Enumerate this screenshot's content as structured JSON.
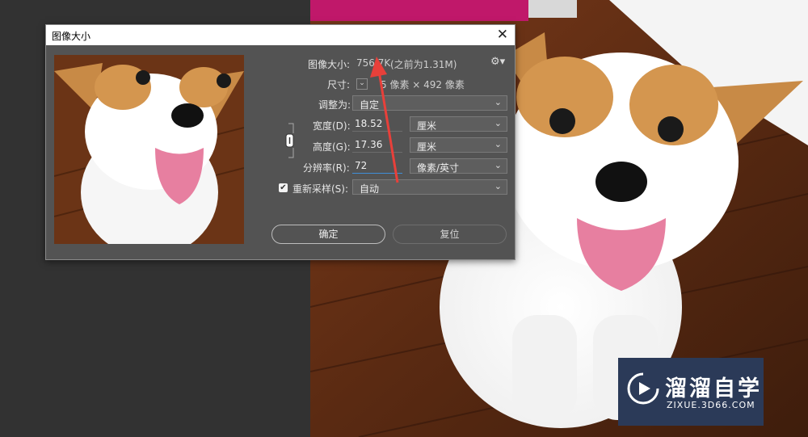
{
  "dialog": {
    "title": "图像大小",
    "close_glyph": "✕",
    "image_size_label": "图像大小:",
    "image_size_value": "756.7K",
    "image_size_prev": "(之前为1.31M)",
    "dimensions_label": "尺寸:",
    "dimensions_value": "5 像素 × 492 像素",
    "fit_label": "调整为:",
    "fit_value": "自定",
    "width_label": "宽度(D):",
    "width_value": "18.52",
    "width_unit": "厘米",
    "height_label": "高度(G):",
    "height_value": "17.36",
    "height_unit": "厘米",
    "resolution_label": "分辨率(R):",
    "resolution_value": "72",
    "resolution_unit": "像素/英寸",
    "resample_label": "重新采样(S):",
    "resample_checked": true,
    "resample_value": "自动",
    "ok_label": "确定",
    "reset_label": "复位",
    "gear_icon": "gear-icon",
    "chain_icon": "link-icon"
  },
  "watermark": {
    "title": "溜溜自学",
    "url": "ZIXUE.3D66.COM"
  },
  "colors": {
    "workspace": "#323232",
    "dialog_bg": "#535353",
    "arrow": "#e8403a",
    "focus_line": "#3f8ed8",
    "watermark_bg": "#2b3a58"
  }
}
